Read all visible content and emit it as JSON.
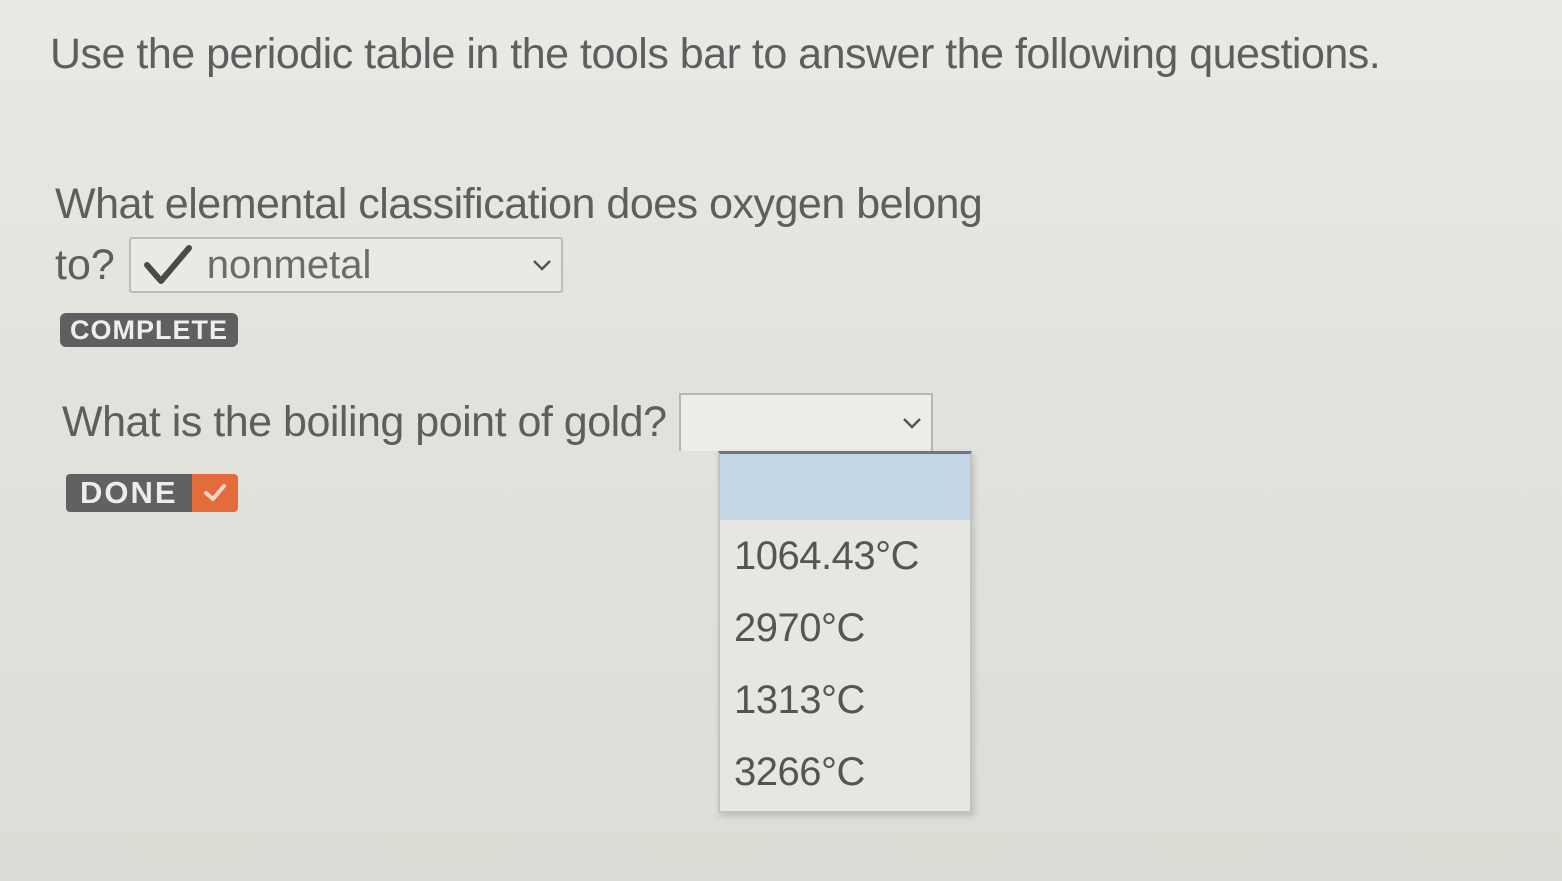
{
  "instructions": "Use the periodic table in the tools bar to answer the following questions.",
  "question1": {
    "text_line1": "What elemental classification does oxygen belong",
    "text_line2": "to?",
    "selected_value": "nonmetal",
    "status_badge": "COMPLETE"
  },
  "question2": {
    "text": "What is the boiling point of gold?",
    "selected_value": "",
    "options": [
      "1064.43°C",
      "2970°C",
      "1313°C",
      "3266°C"
    ],
    "status_badge": "DONE"
  },
  "colors": {
    "check_mark": "#4a4a4a",
    "badge_gray": "#5f5f5f",
    "done_accent": "#e36b3c",
    "option_highlight": "#c2d6e6"
  },
  "icons": [
    "check-icon",
    "chevron-down-icon",
    "done-check-icon"
  ]
}
